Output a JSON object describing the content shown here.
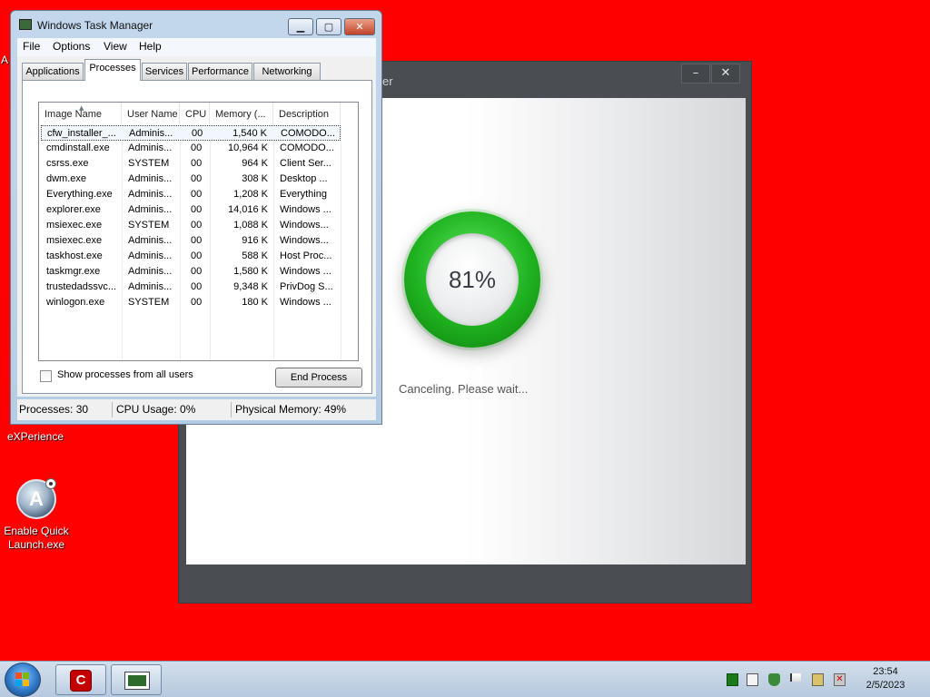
{
  "desktop": {
    "clipped_label": "A",
    "icons": [
      {
        "label": "eXPerience"
      },
      {
        "label": "Enable Quick Launch.exe"
      }
    ]
  },
  "installer": {
    "title_fragment": "er",
    "minimize_glyph": "–",
    "close_glyph": "✕",
    "progress_percent": 81,
    "progress_label": "81%",
    "status_text": "Canceling. Please wait..."
  },
  "taskmgr": {
    "title": "Windows Task Manager",
    "menu": [
      "File",
      "Options",
      "View",
      "Help"
    ],
    "tabs": [
      "Applications",
      "Processes",
      "Services",
      "Performance",
      "Networking"
    ],
    "active_tab": "Processes",
    "columns": [
      "Image Name",
      "User Name",
      "CPU",
      "Memory (...",
      "Description"
    ],
    "rows": [
      {
        "image": "cfw_installer_...",
        "user": "Adminis...",
        "cpu": "00",
        "mem": "1,540 K",
        "desc": "COMODO..."
      },
      {
        "image": "cmdinstall.exe",
        "user": "Adminis...",
        "cpu": "00",
        "mem": "10,964 K",
        "desc": "COMODO..."
      },
      {
        "image": "csrss.exe",
        "user": "SYSTEM",
        "cpu": "00",
        "mem": "964 K",
        "desc": "Client Ser..."
      },
      {
        "image": "dwm.exe",
        "user": "Adminis...",
        "cpu": "00",
        "mem": "308 K",
        "desc": "Desktop ..."
      },
      {
        "image": "Everything.exe",
        "user": "Adminis...",
        "cpu": "00",
        "mem": "1,208 K",
        "desc": "Everything"
      },
      {
        "image": "explorer.exe",
        "user": "Adminis...",
        "cpu": "00",
        "mem": "14,016 K",
        "desc": "Windows ..."
      },
      {
        "image": "msiexec.exe",
        "user": "SYSTEM",
        "cpu": "00",
        "mem": "1,088 K",
        "desc": "Windows..."
      },
      {
        "image": "msiexec.exe",
        "user": "Adminis...",
        "cpu": "00",
        "mem": "916 K",
        "desc": "Windows..."
      },
      {
        "image": "taskhost.exe",
        "user": "Adminis...",
        "cpu": "00",
        "mem": "588 K",
        "desc": "Host Proc..."
      },
      {
        "image": "taskmgr.exe",
        "user": "Adminis...",
        "cpu": "00",
        "mem": "1,580 K",
        "desc": "Windows ..."
      },
      {
        "image": "trustedadssvc...",
        "user": "Adminis...",
        "cpu": "00",
        "mem": "9,348 K",
        "desc": "PrivDog S..."
      },
      {
        "image": "winlogon.exe",
        "user": "SYSTEM",
        "cpu": "00",
        "mem": "180 K",
        "desc": "Windows ..."
      }
    ],
    "selected_row": 0,
    "show_all_label": "Show processes from all users",
    "show_all_checked": false,
    "end_process_label": "End Process",
    "status": {
      "processes": "Processes: 30",
      "cpu": "CPU Usage: 0%",
      "memory": "Physical Memory: 49%"
    }
  },
  "taskbar": {
    "clock_time": "23:54",
    "clock_date": "2/5/2023",
    "buttons": [
      "comodo-firewall",
      "task-manager"
    ],
    "tray_icons": [
      "network-icon",
      "clipboard-icon",
      "security-shield-icon",
      "action-center-flag-icon",
      "network-connection-icon",
      "volume-muted-icon"
    ]
  },
  "colors": {
    "desktop_background": "#fe0000",
    "progress_ring": "#1fb21f",
    "installer_frame": "#4a4d52"
  }
}
